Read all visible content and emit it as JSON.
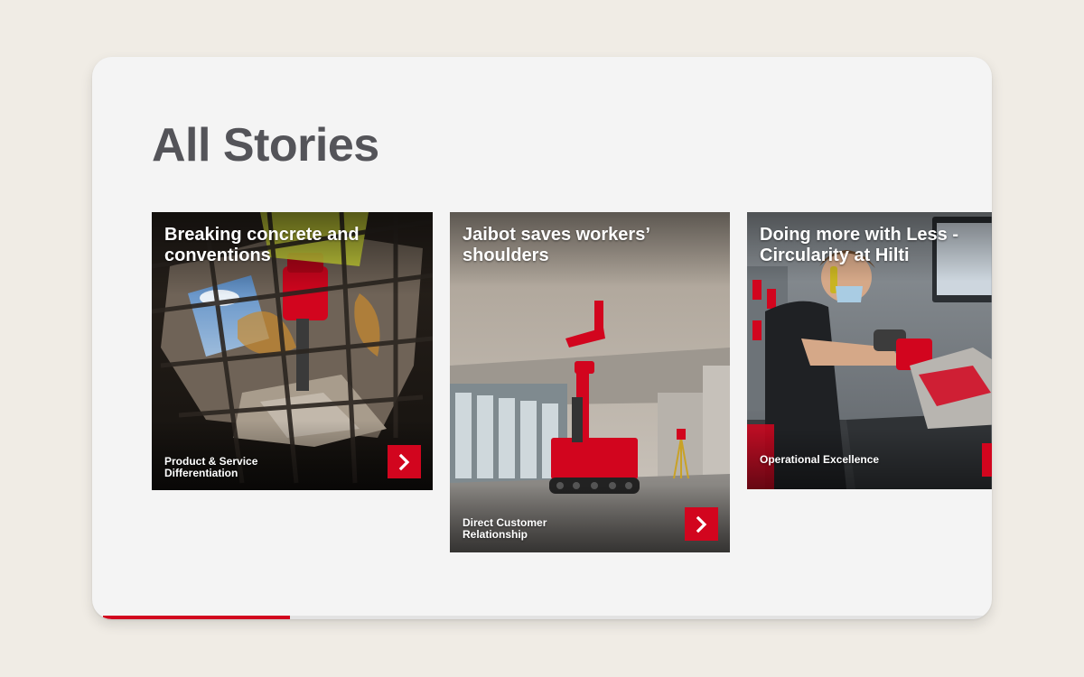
{
  "page": {
    "title": "All Stories"
  },
  "colors": {
    "accent": "#d2051e",
    "title": "#545459",
    "panel": "#f4f4f4",
    "background": "#f0ece5"
  },
  "stories": [
    {
      "title": "Breaking concrete and conventions",
      "tag": "Product & Service Differentiation",
      "image": "construction-worker-demolition-hammer-photo"
    },
    {
      "title": "Jaibot saves workers’ shoulders",
      "tag": "Direct Customer Relationship",
      "image": "jaibot-drilling-robot-photo"
    },
    {
      "title": "Doing more with Less - Circularity at Hilti",
      "tag": "Operational Excellence",
      "image": "workshop-tool-repair-photo"
    }
  ],
  "carousel": {
    "progress": 0.21
  },
  "icons": {
    "next": "chevron-right-icon"
  }
}
